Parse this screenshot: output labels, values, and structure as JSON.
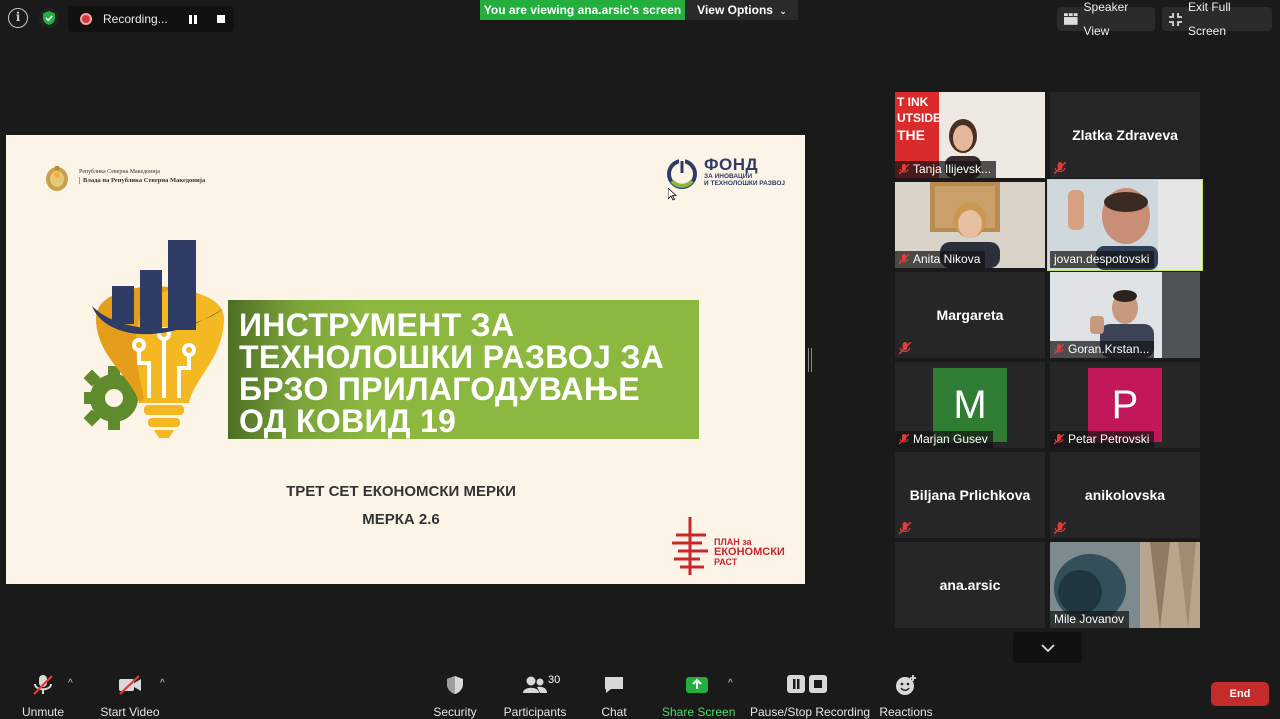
{
  "top": {
    "recording_label": "Recording...",
    "viewing_banner": "You are viewing ana.arsic's screen",
    "view_options": "View Options",
    "speaker_view": "Speaker View",
    "exit_full_screen": "Exit Full Screen"
  },
  "slide": {
    "gov_line1": "Република Северна Македонија",
    "gov_line2": "Влада на Република Северна Македонија",
    "fond_title": "ФОНД",
    "fond_sub1": "ЗА ИНОВАЦИИ",
    "fond_sub2": "И ТЕХНОЛОШКИ РАЗВОЈ",
    "title_lines": [
      "ИНСТРУМЕНТ ЗА",
      "ТЕХНОЛОШКИ РАЗВОЈ ЗА",
      "БРЗО ПРИЛАГОДУВАЊЕ",
      "ОД КОВИД 19"
    ],
    "subtitle1": "ТРЕТ СЕТ ЕКОНОМСКИ МЕРКИ",
    "subtitle2": "МЕРКА 2.6",
    "plan_line1": "ПЛАН за",
    "plan_line2": "ЕКОНОМСКИ",
    "plan_line3": "РАСТ"
  },
  "participants": [
    {
      "name": "Tanja Ilijevsk...",
      "muted": true,
      "video": true
    },
    {
      "name": "Zlatka Zdraveva",
      "muted": true,
      "video": false
    },
    {
      "name": "Anita Nikova",
      "muted": true,
      "video": true
    },
    {
      "name": "jovan.despotovski",
      "muted": false,
      "video": true,
      "active": true
    },
    {
      "name": "Margareta",
      "muted": true,
      "video": false
    },
    {
      "name": "Goran.Krstan...",
      "muted": true,
      "video": true
    },
    {
      "name": "Marjan Gusev",
      "muted": true,
      "video": false,
      "avatar_letter": "M",
      "avatar_color": "#2f7d32"
    },
    {
      "name": "Petar Petrovski",
      "muted": true,
      "video": false,
      "avatar_letter": "P",
      "avatar_color": "#c2185b"
    },
    {
      "name": "Biljana Prlichkova",
      "muted": true,
      "video": false
    },
    {
      "name": "anikolovska",
      "muted": true,
      "video": false
    },
    {
      "name": "ana.arsic",
      "muted": false,
      "video": false
    },
    {
      "name": "Mile Jovanov",
      "muted": false,
      "video": true
    }
  ],
  "toolbar": {
    "unmute": "Unmute",
    "start_video": "Start Video",
    "security": "Security",
    "participants": "Participants",
    "participants_count": "30",
    "chat": "Chat",
    "share_screen": "Share Screen",
    "pause_stop_recording": "Pause/Stop Recording",
    "reactions": "Reactions",
    "end": "End"
  },
  "colors": {
    "green_banner": "#23ae3e",
    "end_red": "#c42b2b",
    "active_outline": "#c4e45a",
    "slide_green": "#8db840"
  }
}
